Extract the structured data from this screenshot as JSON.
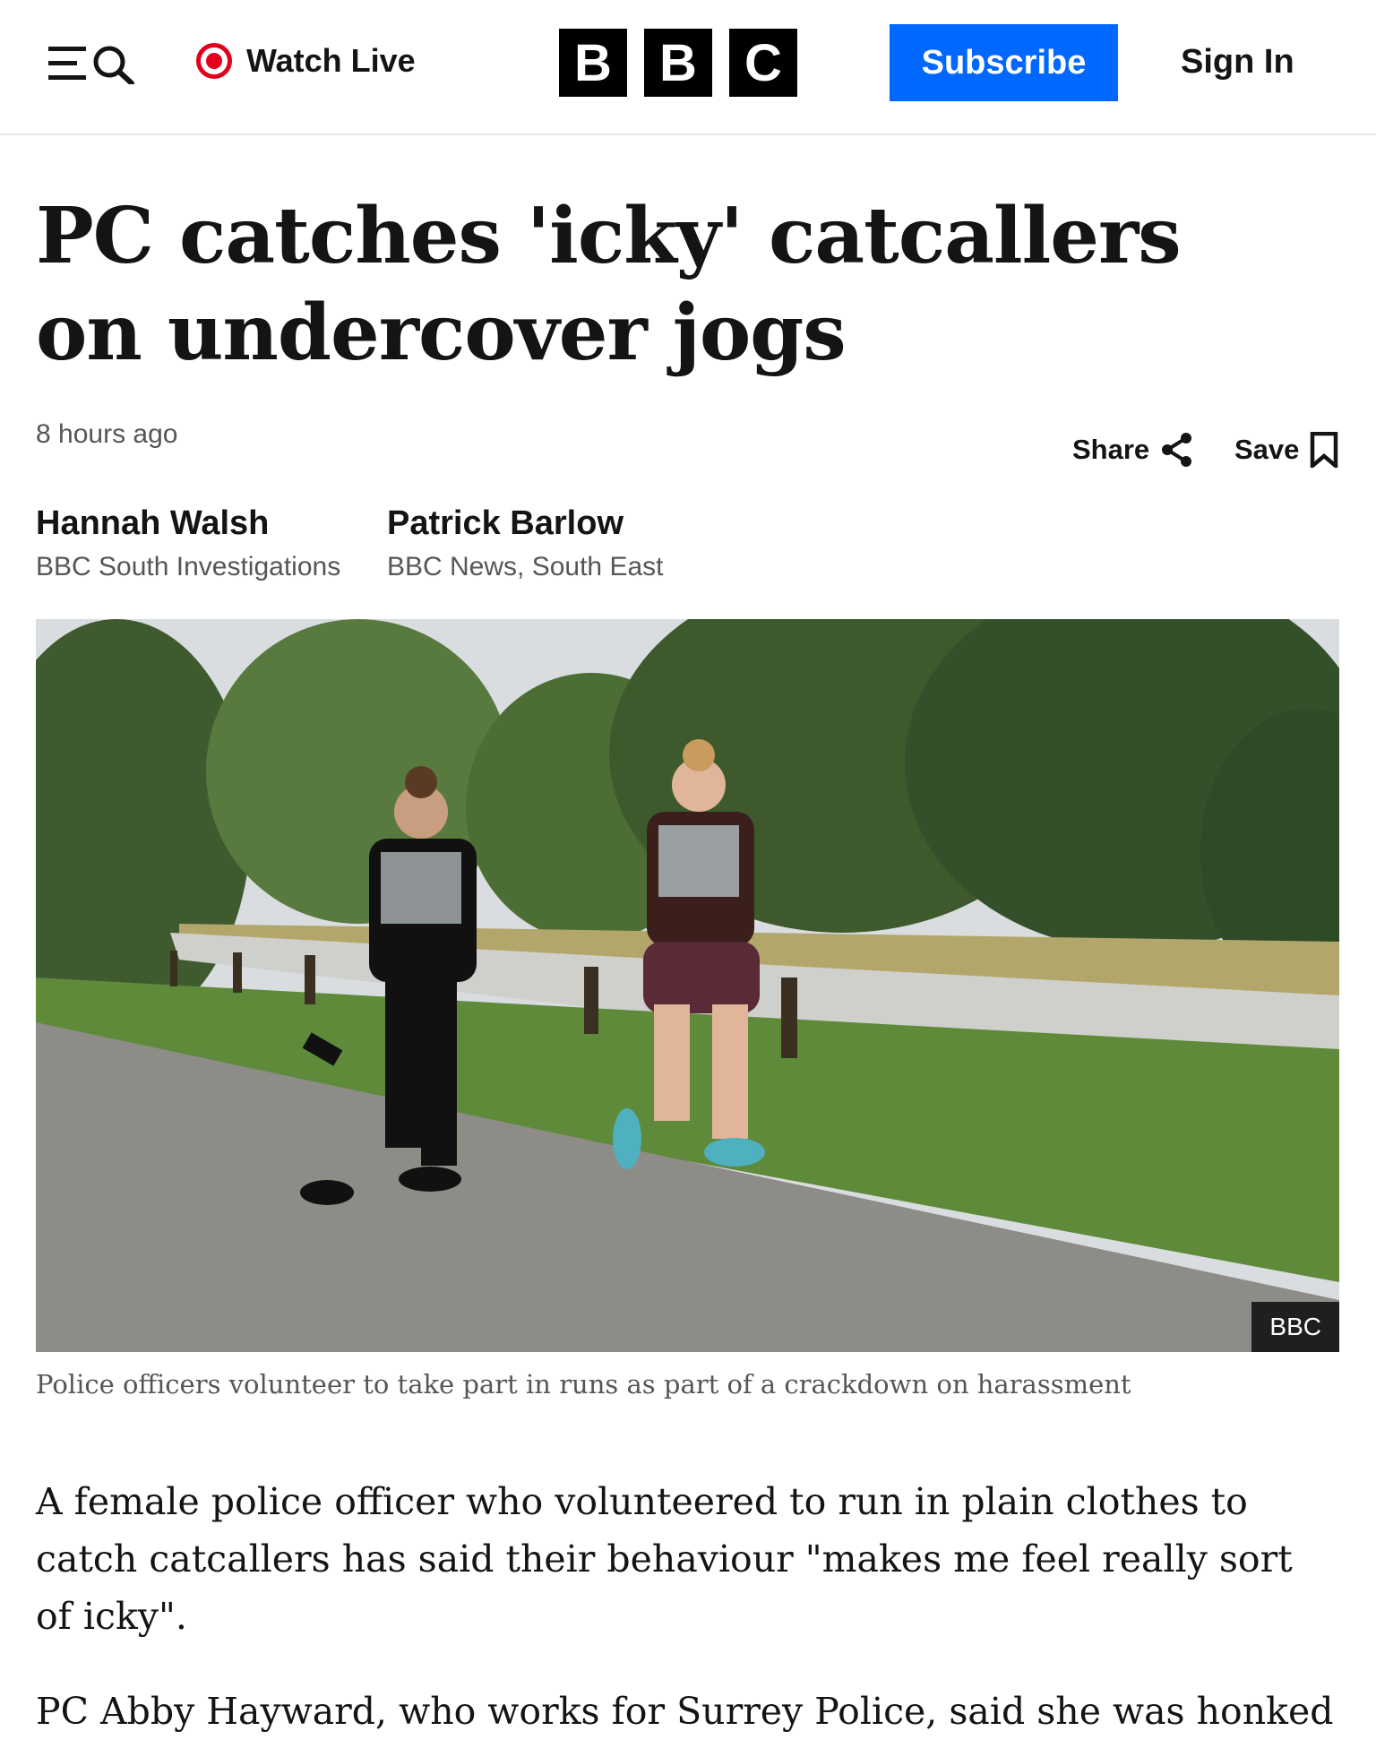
{
  "header": {
    "watch_live_label": "Watch Live",
    "logo_letters": [
      "B",
      "B",
      "C"
    ],
    "subscribe_label": "Subscribe",
    "sign_in_label": "Sign In"
  },
  "article": {
    "headline": "PC catches 'icky' catcallers on undercover jogs",
    "timestamp": "8 hours ago",
    "share_label": "Share",
    "save_label": "Save",
    "bylines": [
      {
        "name": "Hannah Walsh",
        "role": "BBC South Investigations"
      },
      {
        "name": "Patrick Barlow",
        "role": "BBC News, South East"
      }
    ],
    "image": {
      "credit": "BBC",
      "caption": "Police officers volunteer to take part in runs as part of a crackdown on harassment"
    },
    "paragraphs": [
      "A female police officer who volunteered to run in plain clothes to catch catcallers has said their behaviour \"makes me feel really sort of icky\".",
      "PC Abby Hayward, who works for Surrey Police, said she was honked"
    ]
  },
  "colors": {
    "accent_blue": "#0068ff",
    "live_red": "#e3001b",
    "text": "#141414",
    "muted": "#545658"
  },
  "icons": [
    "menu-icon",
    "search-icon",
    "live-indicator-icon",
    "share-icon",
    "bookmark-icon"
  ]
}
